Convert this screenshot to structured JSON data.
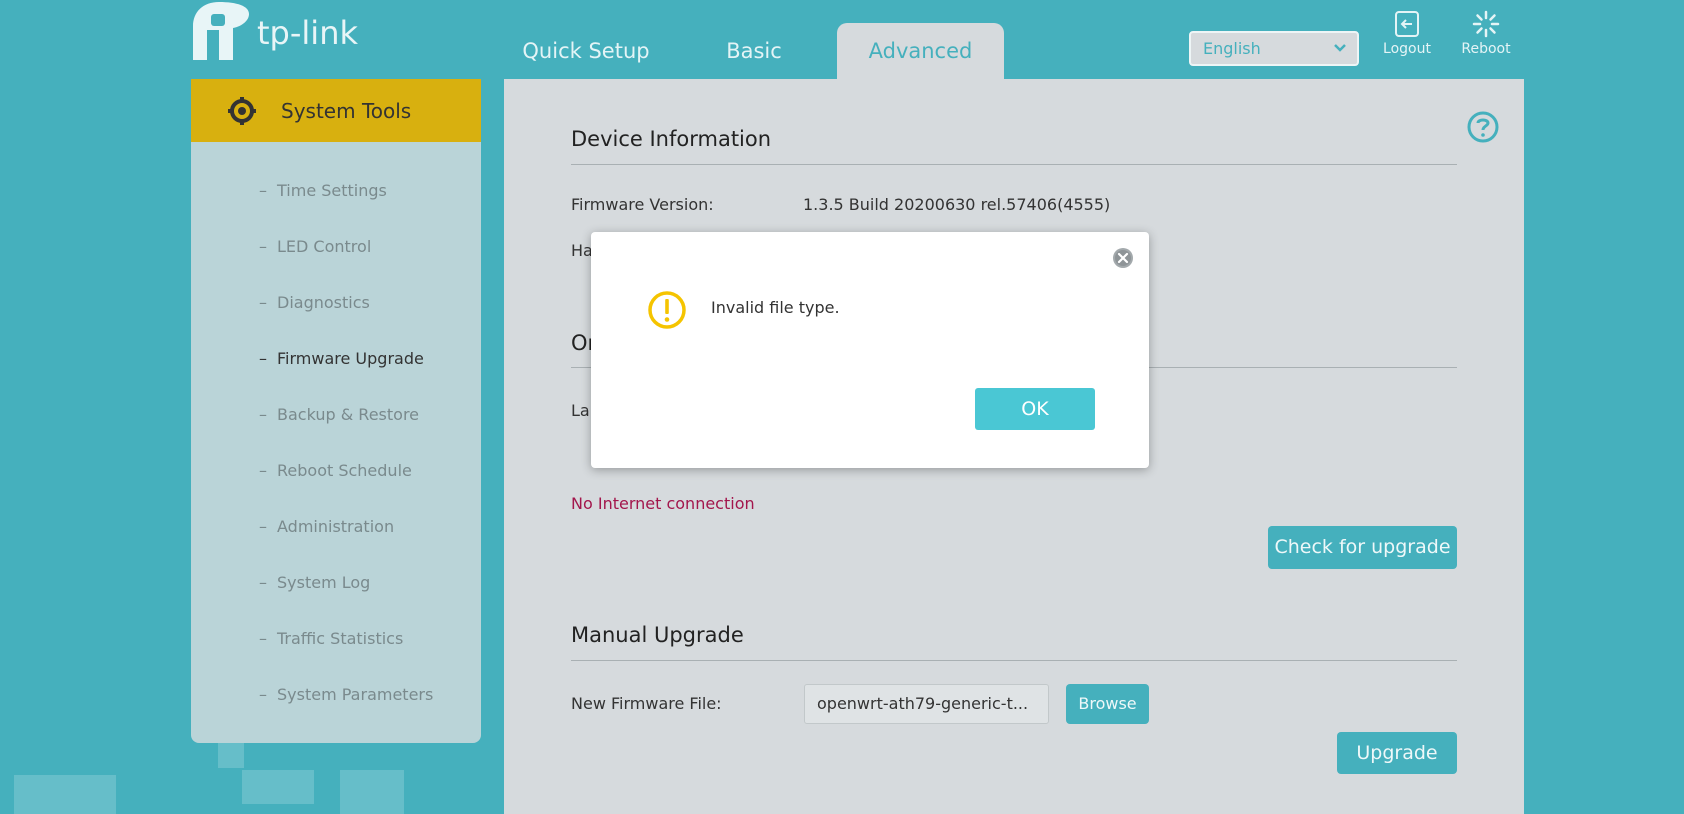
{
  "header": {
    "brand": "tp-link",
    "tabs": [
      {
        "label": "Quick Setup"
      },
      {
        "label": "Basic"
      },
      {
        "label": "Advanced",
        "active": true
      }
    ],
    "language": "English",
    "logout_label": "Logout",
    "reboot_label": "Reboot"
  },
  "sidebar": {
    "section_title": "System Tools",
    "items": [
      {
        "label": "Time Settings"
      },
      {
        "label": "LED Control"
      },
      {
        "label": "Diagnostics"
      },
      {
        "label": "Firmware Upgrade",
        "active": true
      },
      {
        "label": "Backup & Restore"
      },
      {
        "label": "Reboot Schedule"
      },
      {
        "label": "Administration"
      },
      {
        "label": "System Log"
      },
      {
        "label": "Traffic Statistics"
      },
      {
        "label": "System Parameters"
      }
    ]
  },
  "main": {
    "device_info": {
      "title": "Device Information",
      "firmware_label": "Firmware Version:",
      "firmware_value": "1.3.5 Build 20200630 rel.57406(4555)",
      "hardware_label_partial": "Ha"
    },
    "online_upgrade": {
      "title_partial": "Or",
      "latest_label_partial": "La",
      "error": "No Internet connection",
      "check_button": "Check for upgrade"
    },
    "manual_upgrade": {
      "title": "Manual Upgrade",
      "file_label": "New Firmware File:",
      "file_value": "openwrt-ath79-generic-t...",
      "browse_button": "Browse",
      "upgrade_button": "Upgrade"
    }
  },
  "dialog": {
    "message": "Invalid file type.",
    "ok_button": "OK"
  },
  "colors": {
    "background": "#45b0bd",
    "panel": "#d6dadd",
    "sidebar": "#bad4d8",
    "sidebar_header": "#d8b00f",
    "accent": "#45b0bd",
    "error": "#a3164c",
    "warning": "#f5c400"
  }
}
